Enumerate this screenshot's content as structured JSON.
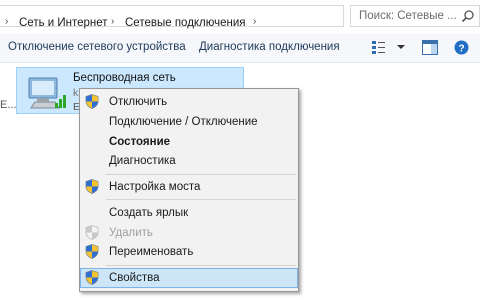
{
  "address_bar": {
    "crumbs": [
      "Сеть и Интернет",
      "Сетевые подключения"
    ],
    "separator": "›",
    "search_placeholder": "Поиск: Сетевые ..."
  },
  "toolbar": {
    "disable_device": "Отключение сетевого устройства",
    "diagnose": "Диагностика подключения"
  },
  "left_edge_text": "E...",
  "network_item": {
    "name": "Беспроводная сеть",
    "sub_partial": "k.....2",
    "sub2_partial": "E"
  },
  "context_menu": {
    "items": [
      {
        "label": "Отключить",
        "shield": true,
        "style": "normal"
      },
      {
        "label": "Подключение / Отключение",
        "shield": false,
        "style": "normal"
      },
      {
        "label": "Состояние",
        "shield": false,
        "style": "bold"
      },
      {
        "label": "Диагностика",
        "shield": false,
        "style": "normal"
      },
      {
        "label": "Настройка моста",
        "shield": true,
        "style": "normal"
      },
      {
        "label": "Создать ярлык",
        "shield": false,
        "style": "normal"
      },
      {
        "label": "Удалить",
        "shield": true,
        "style": "disabled"
      },
      {
        "label": "Переименовать",
        "shield": true,
        "style": "normal"
      },
      {
        "label": "Свойства",
        "shield": true,
        "style": "hover"
      }
    ]
  },
  "colors": {
    "selection_bg": "#cce8ff",
    "selection_border": "#99d1ff",
    "menu_bg": "#f2f2f2",
    "menu_hover": "#cde6f7",
    "toolbar_text": "#1e395b"
  }
}
